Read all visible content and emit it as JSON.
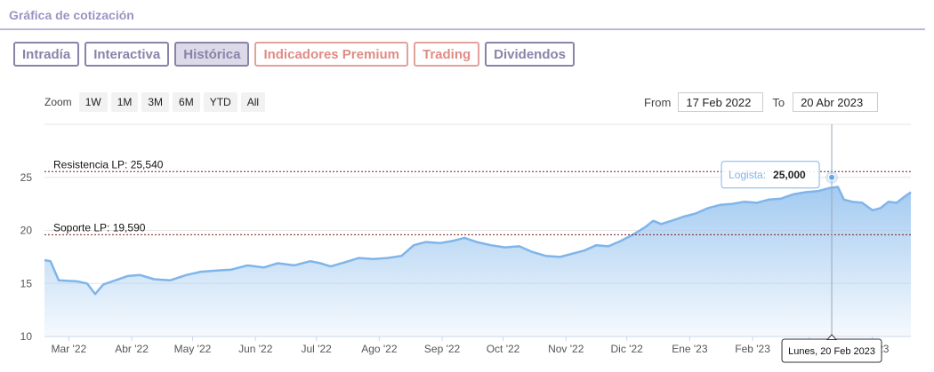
{
  "header": {
    "title": "Gráfica de cotización"
  },
  "tabs": [
    {
      "label": "Intradía",
      "style": "normal"
    },
    {
      "label": "Interactiva",
      "style": "normal"
    },
    {
      "label": "Histórica",
      "style": "active"
    },
    {
      "label": "Indicadores Premium",
      "style": "premium"
    },
    {
      "label": "Trading",
      "style": "premium"
    },
    {
      "label": "Dividendos",
      "style": "normal"
    }
  ],
  "zoom": {
    "label": "Zoom",
    "buttons": [
      "1W",
      "1M",
      "3M",
      "6M",
      "YTD",
      "All"
    ]
  },
  "range": {
    "from_label": "From",
    "from_value": "17 Feb 2022",
    "to_label": "To",
    "to_value": "20 Abr 2023"
  },
  "colors": {
    "area_line": "#7fb5ea",
    "area_fill_top": "#9fc8f0",
    "reference_line": "#7a1f1f",
    "tab_border": "#8a83a8",
    "premium": "#e08b85"
  },
  "chart_data": {
    "type": "area",
    "ylim": [
      10,
      30
    ],
    "yticks": [
      10,
      15,
      20,
      25
    ],
    "x_tick_labels": [
      "Mar '22",
      "Abr '22",
      "May '22",
      "Jun '22",
      "Jul '22",
      "Ago '22",
      "Sep '22",
      "Oct '22",
      "Nov '22",
      "Dic '22",
      "Ene '23",
      "Feb '23",
      "Mar '23",
      "Abr '23"
    ],
    "x_ticks_date": [
      "2022-03-01",
      "2022-04-01",
      "2022-05-01",
      "2022-06-01",
      "2022-07-01",
      "2022-08-01",
      "2022-09-01",
      "2022-10-01",
      "2022-11-01",
      "2022-12-01",
      "2023-01-01",
      "2023-02-01",
      "2023-03-01",
      "2023-04-01"
    ],
    "x_range": [
      "2022-02-17",
      "2023-04-20"
    ],
    "series": [
      {
        "points": [
          [
            "2022-02-17",
            17.2
          ],
          [
            "2022-02-20",
            17.1
          ],
          [
            "2022-02-24",
            15.3
          ],
          [
            "2022-03-05",
            15.2
          ],
          [
            "2022-03-10",
            15.0
          ],
          [
            "2022-03-14",
            14.0
          ],
          [
            "2022-03-18",
            14.9
          ],
          [
            "2022-03-24",
            15.3
          ],
          [
            "2022-03-30",
            15.7
          ],
          [
            "2022-04-05",
            15.8
          ],
          [
            "2022-04-12",
            15.4
          ],
          [
            "2022-04-20",
            15.3
          ],
          [
            "2022-04-28",
            15.8
          ],
          [
            "2022-05-05",
            16.1
          ],
          [
            "2022-05-12",
            16.2
          ],
          [
            "2022-05-20",
            16.3
          ],
          [
            "2022-05-28",
            16.7
          ],
          [
            "2022-06-05",
            16.5
          ],
          [
            "2022-06-12",
            16.9
          ],
          [
            "2022-06-20",
            16.7
          ],
          [
            "2022-06-28",
            17.1
          ],
          [
            "2022-07-03",
            16.9
          ],
          [
            "2022-07-08",
            16.6
          ],
          [
            "2022-07-15",
            17.0
          ],
          [
            "2022-07-22",
            17.4
          ],
          [
            "2022-07-29",
            17.3
          ],
          [
            "2022-08-05",
            17.4
          ],
          [
            "2022-08-12",
            17.6
          ],
          [
            "2022-08-18",
            18.6
          ],
          [
            "2022-08-24",
            18.9
          ],
          [
            "2022-08-31",
            18.8
          ],
          [
            "2022-09-06",
            19.0
          ],
          [
            "2022-09-12",
            19.3
          ],
          [
            "2022-09-18",
            18.9
          ],
          [
            "2022-09-25",
            18.6
          ],
          [
            "2022-10-02",
            18.4
          ],
          [
            "2022-10-09",
            18.5
          ],
          [
            "2022-10-15",
            18.0
          ],
          [
            "2022-10-22",
            17.6
          ],
          [
            "2022-10-29",
            17.5
          ],
          [
            "2022-11-04",
            17.8
          ],
          [
            "2022-11-10",
            18.1
          ],
          [
            "2022-11-16",
            18.6
          ],
          [
            "2022-11-22",
            18.5
          ],
          [
            "2022-11-28",
            19.0
          ],
          [
            "2022-12-04",
            19.6
          ],
          [
            "2022-12-10",
            20.3
          ],
          [
            "2022-12-14",
            20.9
          ],
          [
            "2022-12-18",
            20.6
          ],
          [
            "2022-12-23",
            20.9
          ],
          [
            "2022-12-29",
            21.3
          ],
          [
            "2023-01-04",
            21.6
          ],
          [
            "2023-01-10",
            22.1
          ],
          [
            "2023-01-16",
            22.4
          ],
          [
            "2023-01-22",
            22.5
          ],
          [
            "2023-01-28",
            22.7
          ],
          [
            "2023-02-03",
            22.6
          ],
          [
            "2023-02-09",
            22.9
          ],
          [
            "2023-02-15",
            23.0
          ],
          [
            "2023-02-21",
            23.4
          ],
          [
            "2023-02-27",
            23.6
          ],
          [
            "2023-03-05",
            23.7
          ],
          [
            "2023-03-11",
            24.0
          ],
          [
            "2023-03-15",
            24.1
          ],
          [
            "2023-03-18",
            22.9
          ],
          [
            "2023-03-22",
            22.7
          ],
          [
            "2023-03-27",
            22.6
          ],
          [
            "2023-04-01",
            21.9
          ],
          [
            "2023-04-05",
            22.1
          ],
          [
            "2023-04-09",
            22.7
          ],
          [
            "2023-04-13",
            22.6
          ],
          [
            "2023-04-17",
            23.2
          ],
          [
            "2023-04-20",
            23.6
          ]
        ]
      }
    ],
    "reference_lines": [
      {
        "label": "Resistencia LP: 25,540",
        "value": 25.54
      },
      {
        "label": "Soporte LP: 19,590",
        "value": 19.59
      }
    ],
    "tooltip": {
      "series_label": "Logista",
      "value": "25,000",
      "date_label": "Lunes, 20 Feb 2023",
      "date": "2023-03-12",
      "y": 25.0
    },
    "grid": true
  }
}
